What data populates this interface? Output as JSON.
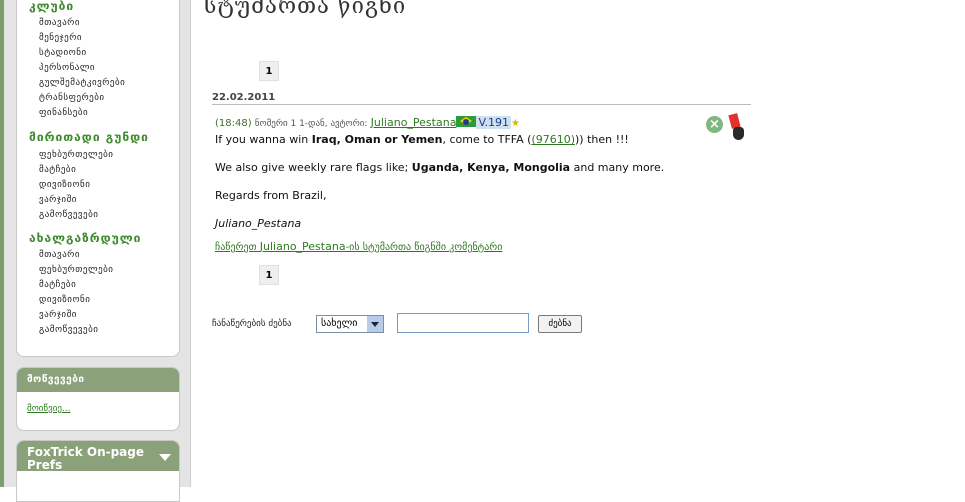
{
  "page_title": "სტუმართა წიგნი",
  "sidebar": {
    "sections": [
      {
        "heading": "კლუბი",
        "items": [
          "მთავარი",
          "მენეჯერი",
          "სტადიონი",
          "პერსონალი",
          "გულშემატკივრები",
          "ტრანსფერები",
          "ფინანსები"
        ]
      },
      {
        "heading": "მირითადი გუნდი",
        "items": [
          "ფეხბურთელები",
          "მატჩები",
          "დივიზიონი",
          "ვარჯიში",
          "გამოწვევები"
        ]
      },
      {
        "heading": "ახალგაზრდული",
        "items": [
          "მთავარი",
          "ფეხბურთელები",
          "მატჩები",
          "დივიზიონი",
          "ვარჯიში",
          "გამოწვევები"
        ]
      }
    ],
    "box2": {
      "title": "მოწვევები",
      "link": "მოიწვიე..."
    },
    "box3": {
      "title": "FoxTrick On-page Prefs"
    }
  },
  "pager": {
    "top": "1",
    "bottom": "1"
  },
  "post": {
    "date": "22.02.2011",
    "time": "(18:48)",
    "meta_text": "ნომერი 1 1-დან, ავტორი:",
    "author": "Juliano_Pestana",
    "version": "V.191",
    "line1_a": "If you wanna win ",
    "line1_b": "Iraq, Oman or Yemen",
    "line1_c": ", come to TFFA (",
    "line1_link": "(97610)",
    "line1_d": ")) then !!!",
    "line2_a": "We also give weekly rare flags like; ",
    "line2_b": "Uganda, Kenya, Mongolia",
    "line2_c": " and many more.",
    "line3": "Regards from Brazil,",
    "signature": "Juliano_Pestana",
    "reply_prefix": "ჩაწერეთ ",
    "reply_name": "Juliano_Pestana",
    "reply_suffix": "-ის სტუმართა წიგნში  კომენტარი"
  },
  "search": {
    "label": "ჩანაწერების ძებნა",
    "select_value": "სახელი",
    "input_value": "",
    "button_label": "ძებნა"
  },
  "colors": {
    "accent_green": "#3d8a2c",
    "box_header": "#8aa17a",
    "link": "#2f7a21"
  }
}
